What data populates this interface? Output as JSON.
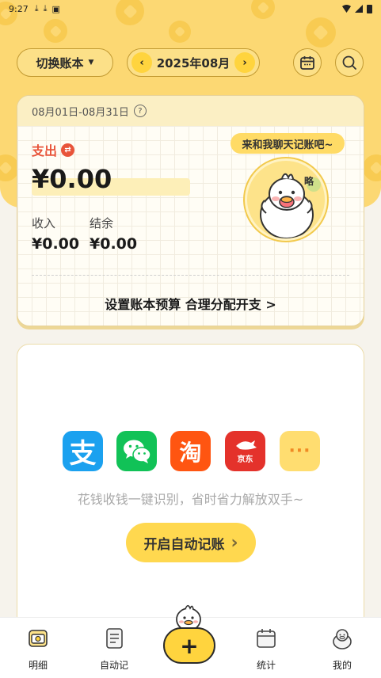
{
  "status_bar": {
    "time": "9:27"
  },
  "header": {
    "switch_book_label": "切换账本",
    "month_label": "2025年08月",
    "prev_arrow": "‹",
    "next_arrow": "›"
  },
  "summary": {
    "date_range": "08月01日-08月31日",
    "help_symbol": "?",
    "expense_label": "支出",
    "expense_value": "¥0.00",
    "income_label": "收入",
    "income_value": "¥0.00",
    "balance_label": "结余",
    "balance_value": "¥0.00",
    "budget_link": "设置账本预算 合理分配开支 >",
    "chat_bubble": "来和我聊天记账吧~",
    "mascot_badge": "略"
  },
  "auto_bookkeeping": {
    "apps": [
      {
        "name": "alipay",
        "glyph": "支"
      },
      {
        "name": "wechat",
        "glyph": ""
      },
      {
        "name": "taobao",
        "glyph": "淘"
      },
      {
        "name": "jd",
        "glyph": "京东"
      },
      {
        "name": "more",
        "glyph": "···"
      }
    ],
    "description": "花钱收钱一键识别，省时省力解放双手~",
    "button_label": "开启自动记账",
    "button_arrow": "›"
  },
  "tabs": [
    {
      "label": "明细",
      "icon": "receipt-icon"
    },
    {
      "label": "自动记",
      "icon": "notebook-icon"
    },
    {
      "label": "统计",
      "icon": "calendar-stats-icon"
    },
    {
      "label": "我的",
      "icon": "duck-profile-icon"
    }
  ],
  "add_button": {
    "label": "+"
  },
  "colors": {
    "brand_yellow": "#fcd873",
    "accent_yellow": "#ffd43e",
    "expense_red": "#e8543a",
    "alipay_blue": "#1ba1ef",
    "wechat_green": "#11c257",
    "taobao_orange": "#ff5511",
    "jd_red": "#e4322b"
  }
}
